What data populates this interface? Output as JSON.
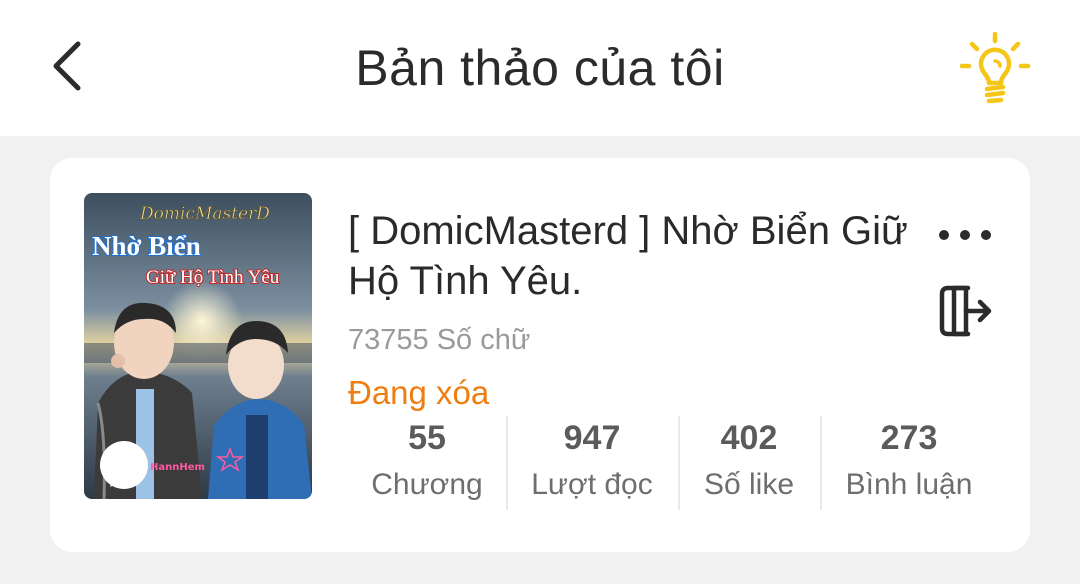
{
  "header": {
    "title": "Bản thảo của tôi",
    "back_icon": "chevron-left-icon",
    "tip_icon": "lightbulb-icon",
    "tip_color": "#f5c518"
  },
  "draft": {
    "cover": {
      "brand_text": "DomicMasterD",
      "title_line1": "Nhờ Biển",
      "title_line2": "Giữ Hộ Tình Yêu",
      "watermark": "HannHem"
    },
    "title": "[ DomicMasterd ] Nhờ Biển Giữ Hộ Tình Yêu.",
    "word_count": "73755 Số chữ",
    "status": "Đang xóa",
    "status_color": "#ef7d10",
    "more_icon": "more-horizontal-icon",
    "exit_icon": "exit-icon",
    "stats": [
      {
        "value": "55",
        "label": "Chương"
      },
      {
        "value": "947",
        "label": "Lượt đọc"
      },
      {
        "value": "402",
        "label": "Số like"
      },
      {
        "value": "273",
        "label": "Bình luận"
      }
    ]
  }
}
